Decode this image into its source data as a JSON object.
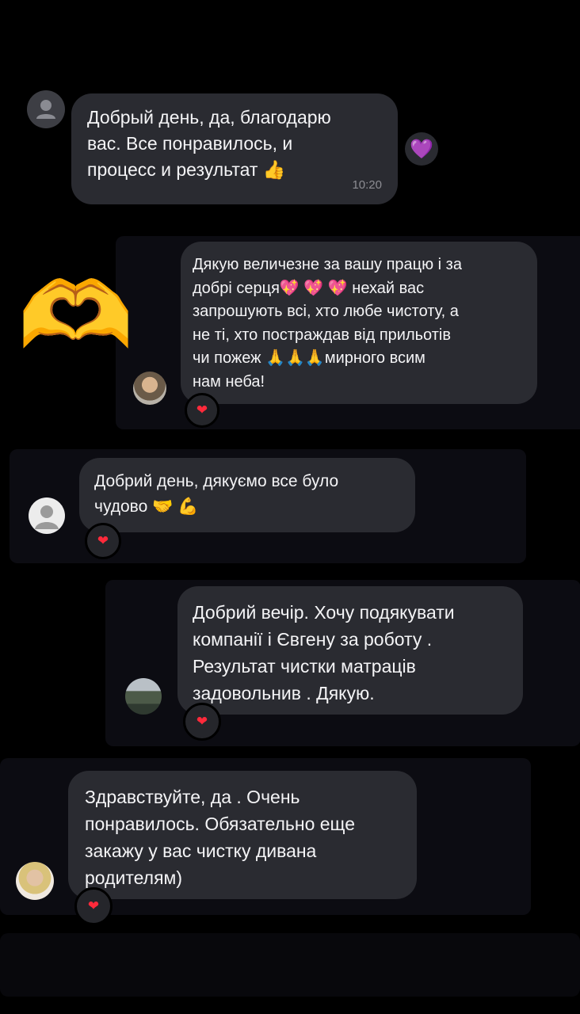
{
  "messages": [
    {
      "lines": [
        "Добрый день, да, благодарю",
        "вас. Все понравилось, и",
        "процесс и результат"
      ],
      "trailing_emoji": "👍",
      "time": "10:20",
      "reaction": "💜"
    },
    {
      "lines": [
        "Дякую величезне за вашу працю і за",
        "добрі серця",
        "нехай вас",
        "запрошують всі, хто любе чистоту, а",
        "не ті, хто постраждав від прильотів",
        "чи пожеж",
        "мирного всим",
        "нам неба!"
      ],
      "emoji_sparkle_hearts": "💖 💖 💖",
      "emoji_pray": "🙏🙏🙏",
      "side_emoji": "🫶",
      "reaction": "❤"
    },
    {
      "lines": [
        "Добрий день, дякуємо все було",
        "чудово"
      ],
      "trailing_emoji": "🤝 💪",
      "reaction": "❤"
    },
    {
      "lines": [
        "Добрий вечір. Хочу подякувати",
        "компанії і Євгену за роботу .",
        "Результат чистки матраців",
        "задовольнив . Дякую."
      ],
      "reaction": "❤"
    },
    {
      "lines": [
        "Здравствуйте, да . Очень",
        "понравилось. Обязательно еще",
        "закажу у вас  чистку дивана",
        "родителям)"
      ],
      "reaction": "❤"
    }
  ],
  "colors": {
    "background": "#000000",
    "panel": "#0c0c12",
    "bubble": "#2a2b31",
    "text": "#f4f4f6",
    "time": "#8d8d93",
    "heart_red": "#ff2a3b",
    "heart_purple": "#7a52ff"
  }
}
